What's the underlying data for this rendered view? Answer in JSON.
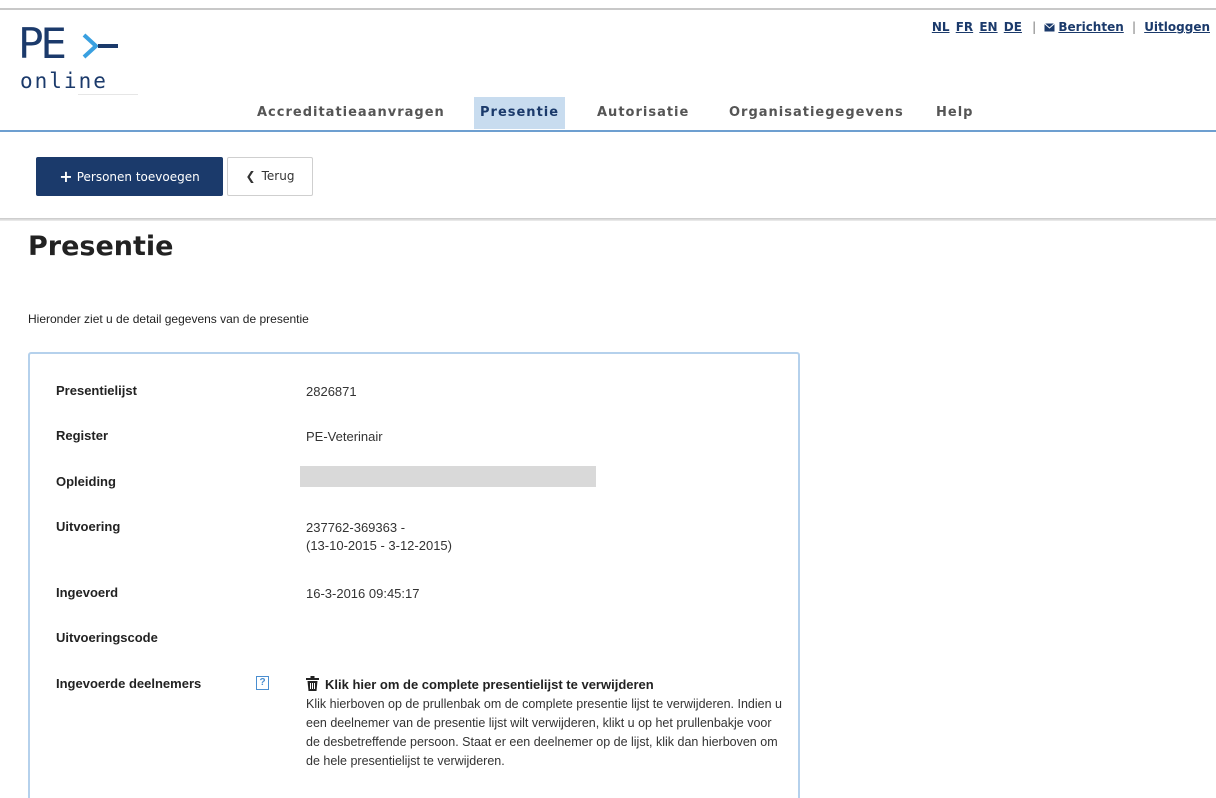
{
  "logo": {
    "mark": "PE",
    "sub": "online"
  },
  "toplinks": {
    "languages": [
      "NL",
      "FR",
      "EN",
      "DE"
    ],
    "separator": "|",
    "messages": "Berichten",
    "logout": "Uitloggen"
  },
  "nav": {
    "items": [
      {
        "label": "Accreditatieaanvragen",
        "active": false
      },
      {
        "label": "Presentie",
        "active": true
      },
      {
        "label": "Autorisatie",
        "active": false
      },
      {
        "label": "Organisatiegegevens",
        "active": false
      },
      {
        "label": "Help",
        "active": false
      }
    ]
  },
  "toolbar": {
    "add_label": "Personen toevoegen",
    "back_label": "Terug"
  },
  "page": {
    "title": "Presentie",
    "intro": "Hieronder ziet u de detail gegevens van de presentie"
  },
  "details": {
    "presentielijst": {
      "label": "Presentielijst",
      "value": "2826871"
    },
    "register": {
      "label": "Register",
      "value": "PE-Veterinair"
    },
    "opleiding": {
      "label": "Opleiding",
      "value": ""
    },
    "uitvoering": {
      "label": "Uitvoering",
      "line1": "237762-369363 -",
      "line2": "(13-10-2015 - 3-12-2015)"
    },
    "ingevoerd": {
      "label": "Ingevoerd",
      "value": "16-3-2016 09:45:17"
    },
    "uitvoeringscode": {
      "label": "Uitvoeringscode",
      "value": ""
    },
    "deelnemers": {
      "label": "Ingevoerde deelnemers",
      "help_glyph": "?",
      "delete_label": "Klik hier om de complete presentielijst te verwijderen",
      "description": "Klik hierboven op de prullenbak om de complete presentie lijst te verwijderen. Indien u een deelnemer van de presentie lijst wilt verwijderen, klikt u op het prullenbakje voor de desbetreffende persoon. Staat er een deelnemer op de lijst, klik dan hierboven om de hele presentielijst te verwijderen."
    }
  },
  "colors": {
    "brand": "#1b3a6b",
    "nav_active_bg": "#c8dcef",
    "nav_line": "#6d9fd0",
    "card_border": "#b5d1ec",
    "help_blue": "#4a8ed0"
  },
  "icons": {
    "messages": "envelope-icon",
    "add": "plus-icon",
    "back": "chevron-left-icon",
    "help": "help-icon",
    "delete": "trash-icon",
    "logo_arrow": "arrow-icon"
  }
}
